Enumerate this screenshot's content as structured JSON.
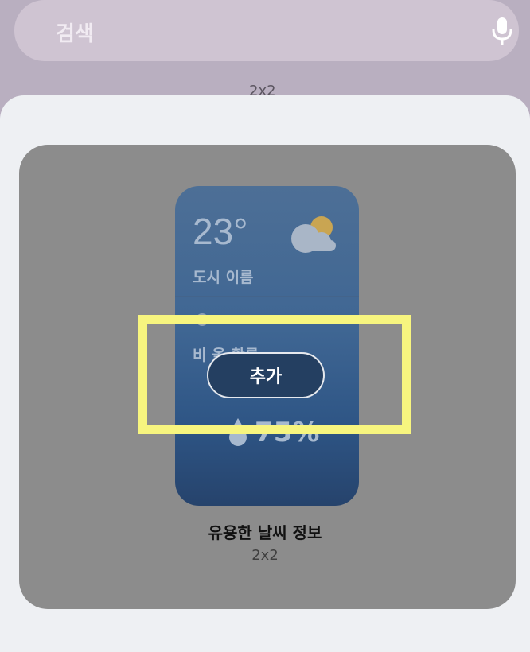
{
  "search": {
    "placeholder": "검색"
  },
  "peek_label": "2x2",
  "widget_preview": {
    "temperature": "23°",
    "city": "도시 이름",
    "rain_label": "비 올 확률",
    "rain_percent": "75%"
  },
  "add_button_label": "추가",
  "widget_title": "유용한 날씨 정보",
  "widget_size": "2x2",
  "colors": {
    "background": "#b9afc0",
    "search_bar": "#cfc4d2",
    "sheet": "#eef0f3",
    "card_overlay": "#8c8c8c",
    "widget_blue": "#3f6693",
    "button": "#243f61",
    "highlight": "#f7f57f"
  },
  "icons": [
    "microphone-icon",
    "partly-cloudy-icon",
    "raindrop-icon"
  ]
}
